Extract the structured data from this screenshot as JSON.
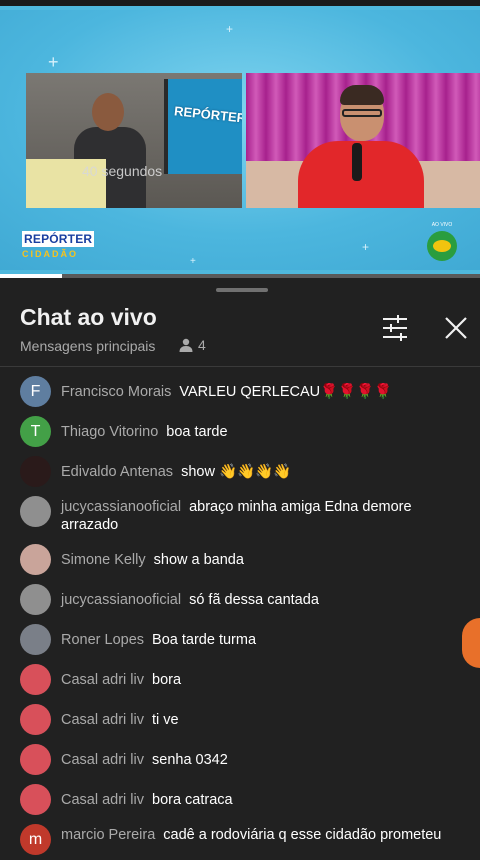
{
  "video": {
    "overlay_timer": "40 segundos",
    "screen_logo": "REPÓRTER",
    "logo_line1": "REPÓRTER",
    "logo_line2": "CIDADÃO",
    "ao_vivo": "AO VIVO",
    "progress_fraction": 0.13
  },
  "chat": {
    "title": "Chat ao vivo",
    "subtitle": "Mensagens principais",
    "viewer_count": "4",
    "messages": [
      {
        "author": "Francisco Morais",
        "text": "VARLEU QERLECAU🌹🌹🌹🌹",
        "avatar_letter": "F",
        "avatar_color": "#5f7ea0"
      },
      {
        "author": "Thiago Vitorino",
        "text": "boa tarde",
        "avatar_letter": "T",
        "avatar_color": "#43a047"
      },
      {
        "author": "Edivaldo Antenas",
        "text": "show 👋👋👋👋",
        "avatar_letter": "",
        "avatar_color": "#2a1a1a"
      },
      {
        "author": "jucycassianooficial",
        "text": "abraço minha amiga Edna demore arrazado",
        "avatar_letter": "",
        "avatar_color": "#8f8f8f"
      },
      {
        "author": "Simone Kelly",
        "text": "show a banda",
        "avatar_letter": "",
        "avatar_color": "#c9a49a"
      },
      {
        "author": "jucycassianooficial",
        "text": "só fã dessa cantada",
        "avatar_letter": "",
        "avatar_color": "#8f8f8f"
      },
      {
        "author": "Roner Lopes",
        "text": "Boa tarde turma",
        "avatar_letter": "",
        "avatar_color": "#7a7f88"
      },
      {
        "author": "Casal adri liv",
        "text": "bora",
        "avatar_letter": "",
        "avatar_color": "#d8505a"
      },
      {
        "author": "Casal adri liv",
        "text": "ti ve",
        "avatar_letter": "",
        "avatar_color": "#d8505a"
      },
      {
        "author": "Casal adri liv",
        "text": "senha 0342",
        "avatar_letter": "",
        "avatar_color": "#d8505a"
      },
      {
        "author": "Casal adri liv",
        "text": "bora catraca",
        "avatar_letter": "",
        "avatar_color": "#d8505a"
      },
      {
        "author": "marcio Pereira",
        "text": "cadê a rodoviária q esse cidadão prometeu",
        "avatar_letter": "m",
        "avatar_color": "#c0392b"
      }
    ]
  },
  "icons": {
    "filter": "tune-icon",
    "close": "close-icon",
    "viewers": "person-icon"
  }
}
